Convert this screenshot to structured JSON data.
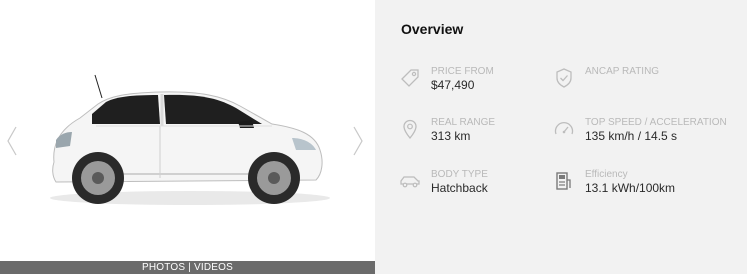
{
  "gallery": {
    "media_label": "PHOTOS | VIDEOS",
    "prev_icon": "chevron-left-icon",
    "next_icon": "chevron-right-icon",
    "car_color": "#f4f4f4"
  },
  "overview": {
    "title": "Overview",
    "specs": [
      {
        "icon": "price-tag-icon",
        "label": "PRICE FROM",
        "value": "$47,490"
      },
      {
        "icon": "shield-check-icon",
        "label": "ANCAP RATING",
        "value": ""
      },
      {
        "icon": "location-pin-icon",
        "label": "REAL RANGE",
        "value": "313 km"
      },
      {
        "icon": "speedometer-icon",
        "label": "TOP SPEED / ACCELERATION",
        "value": "135 km/h / 14.5 s"
      },
      {
        "icon": "car-icon",
        "label": "BODY TYPE",
        "value": "Hatchback"
      },
      {
        "icon": "efficiency-meter-icon",
        "label": "Efficiency",
        "value": "13.1 kWh/100km"
      }
    ]
  },
  "colors": {
    "panel_bg": "#f2f2f2",
    "media_bar_bg": "#6b6b6b",
    "label": "#b9b9b9",
    "value": "#2a2a2a"
  }
}
